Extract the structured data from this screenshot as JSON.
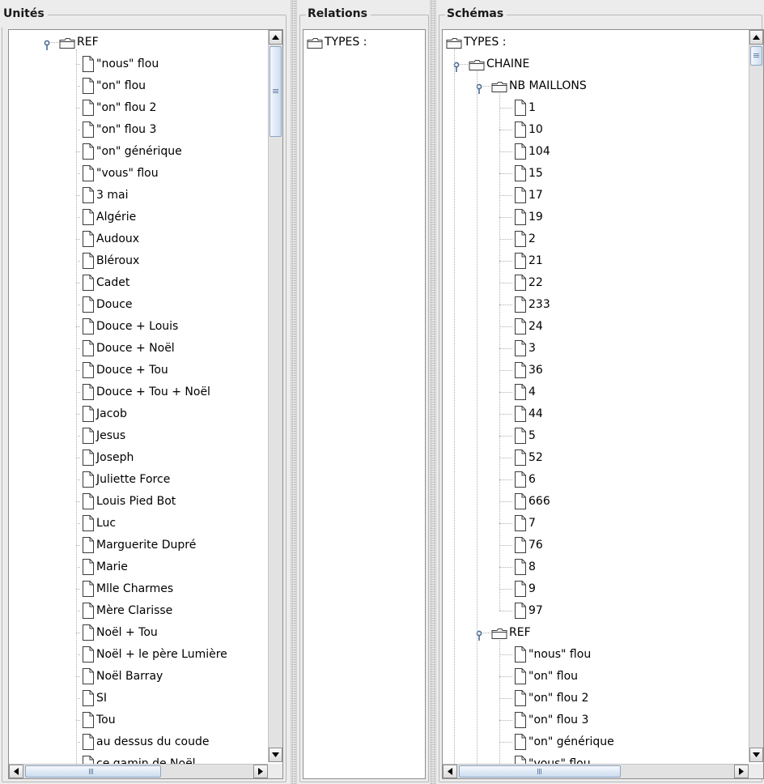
{
  "panels": {
    "unites": {
      "title": "Unités",
      "tree": [
        {
          "label": "REF",
          "type": "folder",
          "depth": 0,
          "expanded": true
        },
        {
          "label": "\"nous\" flou",
          "type": "file",
          "depth": 1
        },
        {
          "label": "\"on\" flou",
          "type": "file",
          "depth": 1
        },
        {
          "label": "\"on\" flou 2",
          "type": "file",
          "depth": 1
        },
        {
          "label": "\"on\" flou 3",
          "type": "file",
          "depth": 1
        },
        {
          "label": "\"on\" générique",
          "type": "file",
          "depth": 1
        },
        {
          "label": "\"vous\" flou",
          "type": "file",
          "depth": 1
        },
        {
          "label": "3 mai",
          "type": "file",
          "depth": 1
        },
        {
          "label": "Algérie",
          "type": "file",
          "depth": 1
        },
        {
          "label": "Audoux",
          "type": "file",
          "depth": 1
        },
        {
          "label": "Bléroux",
          "type": "file",
          "depth": 1
        },
        {
          "label": "Cadet",
          "type": "file",
          "depth": 1
        },
        {
          "label": "Douce",
          "type": "file",
          "depth": 1
        },
        {
          "label": "Douce + Louis",
          "type": "file",
          "depth": 1
        },
        {
          "label": "Douce + Noël",
          "type": "file",
          "depth": 1
        },
        {
          "label": "Douce + Tou",
          "type": "file",
          "depth": 1
        },
        {
          "label": "Douce + Tou + Noël",
          "type": "file",
          "depth": 1
        },
        {
          "label": "Jacob",
          "type": "file",
          "depth": 1
        },
        {
          "label": "Jesus",
          "type": "file",
          "depth": 1
        },
        {
          "label": "Joseph",
          "type": "file",
          "depth": 1
        },
        {
          "label": "Juliette Force",
          "type": "file",
          "depth": 1
        },
        {
          "label": "Louis Pied Bot",
          "type": "file",
          "depth": 1
        },
        {
          "label": "Luc",
          "type": "file",
          "depth": 1
        },
        {
          "label": "Marguerite Dupré",
          "type": "file",
          "depth": 1
        },
        {
          "label": "Marie",
          "type": "file",
          "depth": 1
        },
        {
          "label": "Mlle Charmes",
          "type": "file",
          "depth": 1
        },
        {
          "label": "Mère Clarisse",
          "type": "file",
          "depth": 1
        },
        {
          "label": "Noël + Tou",
          "type": "file",
          "depth": 1
        },
        {
          "label": "Noël + le père Lumière",
          "type": "file",
          "depth": 1
        },
        {
          "label": "Noël Barray",
          "type": "file",
          "depth": 1
        },
        {
          "label": "SI",
          "type": "file",
          "depth": 1
        },
        {
          "label": "Tou",
          "type": "file",
          "depth": 1
        },
        {
          "label": "au dessus du coude",
          "type": "file",
          "depth": 1
        },
        {
          "label": "ce gamin de Noël",
          "type": "file",
          "depth": 1
        }
      ]
    },
    "relations": {
      "title": "Relations",
      "tree": [
        {
          "label": "TYPES :",
          "type": "folder",
          "depth": 0,
          "expanded": false
        }
      ]
    },
    "schemas": {
      "title": "Schémas",
      "tree": [
        {
          "label": "TYPES :",
          "type": "folder",
          "depth": 0,
          "expanded": true
        },
        {
          "label": "CHAINE",
          "type": "folder",
          "depth": 1,
          "expanded": true
        },
        {
          "label": "NB MAILLONS",
          "type": "folder",
          "depth": 2,
          "expanded": true
        },
        {
          "label": "1",
          "type": "file",
          "depth": 3
        },
        {
          "label": "10",
          "type": "file",
          "depth": 3
        },
        {
          "label": "104",
          "type": "file",
          "depth": 3
        },
        {
          "label": "15",
          "type": "file",
          "depth": 3
        },
        {
          "label": "17",
          "type": "file",
          "depth": 3
        },
        {
          "label": "19",
          "type": "file",
          "depth": 3
        },
        {
          "label": "2",
          "type": "file",
          "depth": 3
        },
        {
          "label": "21",
          "type": "file",
          "depth": 3
        },
        {
          "label": "22",
          "type": "file",
          "depth": 3
        },
        {
          "label": "233",
          "type": "file",
          "depth": 3
        },
        {
          "label": "24",
          "type": "file",
          "depth": 3
        },
        {
          "label": "3",
          "type": "file",
          "depth": 3
        },
        {
          "label": "36",
          "type": "file",
          "depth": 3
        },
        {
          "label": "4",
          "type": "file",
          "depth": 3
        },
        {
          "label": "44",
          "type": "file",
          "depth": 3
        },
        {
          "label": "5",
          "type": "file",
          "depth": 3
        },
        {
          "label": "52",
          "type": "file",
          "depth": 3
        },
        {
          "label": "6",
          "type": "file",
          "depth": 3
        },
        {
          "label": "666",
          "type": "file",
          "depth": 3
        },
        {
          "label": "7",
          "type": "file",
          "depth": 3
        },
        {
          "label": "76",
          "type": "file",
          "depth": 3
        },
        {
          "label": "8",
          "type": "file",
          "depth": 3
        },
        {
          "label": "9",
          "type": "file",
          "depth": 3
        },
        {
          "label": "97",
          "type": "file",
          "depth": 3
        },
        {
          "label": "REF",
          "type": "folder",
          "depth": 2,
          "expanded": true
        },
        {
          "label": "\"nous\" flou",
          "type": "file",
          "depth": 3
        },
        {
          "label": "\"on\" flou",
          "type": "file",
          "depth": 3
        },
        {
          "label": "\"on\" flou 2",
          "type": "file",
          "depth": 3
        },
        {
          "label": "\"on\" flou 3",
          "type": "file",
          "depth": 3
        },
        {
          "label": "\"on\" générique",
          "type": "file",
          "depth": 3
        },
        {
          "label": "\"vous\" flou",
          "type": "file",
          "depth": 3
        }
      ]
    }
  },
  "icons": {
    "folder": "folder-icon",
    "file": "document-icon",
    "expanded_handle": "tree-expanded-handle-icon",
    "scroll_up": "arrow-up-icon",
    "scroll_down": "arrow-down-icon",
    "scroll_left": "arrow-left-icon",
    "scroll_right": "arrow-right-icon"
  },
  "colors": {
    "panel_background": "#ececec",
    "tree_background": "#ffffff",
    "scroll_thumb": "#cbdcef",
    "tree_line": "#b0b0b0"
  }
}
